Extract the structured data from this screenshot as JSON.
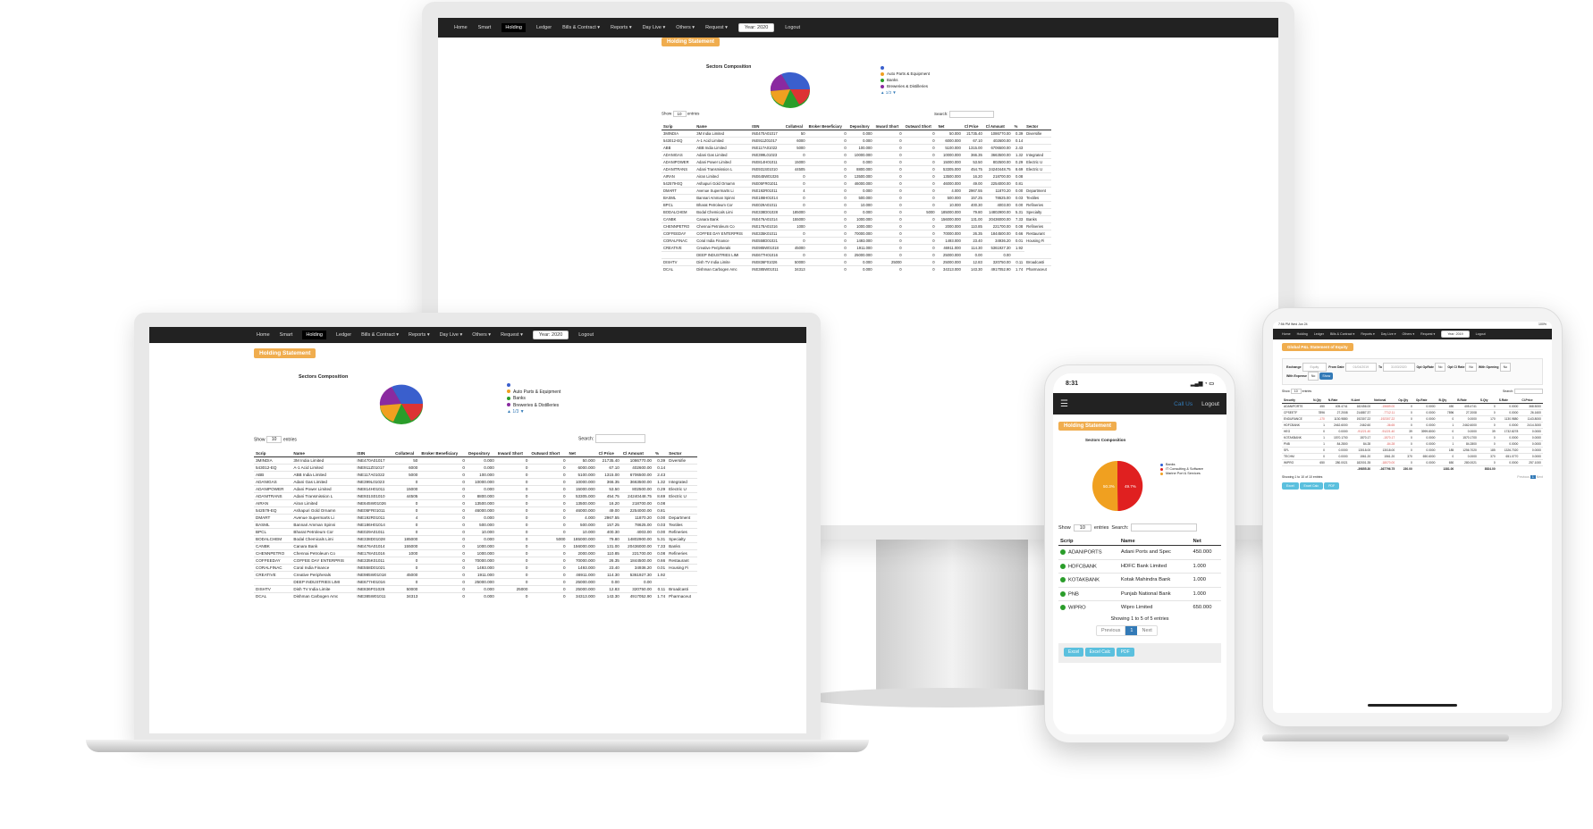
{
  "nav": {
    "items": [
      "Home",
      "Smart",
      "Holding",
      "Ledger",
      "Bills & Contract ▾",
      "Reports ▾",
      "Day Live ▾",
      "Others ▾",
      "Request ▾"
    ],
    "year": "Year: 2020",
    "logout": "Logout"
  },
  "holding": {
    "title": "Holding Statement",
    "chart_title": "Sectors Composition",
    "legend": [
      {
        "label": "",
        "color": "#3a5fcd"
      },
      {
        "label": "Auto Parts & Equipment",
        "color": "#f0a020"
      },
      {
        "label": "Banks",
        "color": "#2a9d2a"
      },
      {
        "label": "Breweries & Distilleries",
        "color": "#8a2aa0"
      }
    ],
    "pager": "1/3",
    "show_prefix": "Show",
    "show_value": "10",
    "show_suffix": "entries",
    "search_label": "Search:",
    "columns": [
      "Scrip",
      "Name",
      "ISIN",
      "Collateral",
      "Broker Beneficiary",
      "Depository",
      "Inward Short",
      "Outward Short",
      "Net",
      "Cl Price",
      "Cl Amount",
      "%",
      "Sector"
    ],
    "rows": [
      [
        "3MINDIA",
        "3M India Limited",
        "INE470A01017",
        "50",
        "0",
        "0.000",
        "0",
        "0",
        "50.000",
        "21735.40",
        "1086770.00",
        "0.39",
        "Diversifie"
      ],
      [
        "543012-EQ",
        "A-1 Acid Limited",
        "INE911Z01017",
        "6000",
        "0",
        "0.000",
        "0",
        "0",
        "6000.000",
        "67.10",
        "402600.00",
        "0.14",
        ""
      ],
      [
        "ABB",
        "ABB India Limited",
        "INE117A01022",
        "5000",
        "0",
        "100.000",
        "0",
        "0",
        "5100.000",
        "1315.00",
        "6706500.00",
        "2.43",
        ""
      ],
      [
        "ADANIGAS",
        "Adani Gas Limited",
        "INE399L01023",
        "0",
        "0",
        "10000.000",
        "0",
        "0",
        "10000.000",
        "366.35",
        "3663500.00",
        "1.32",
        "Integrated"
      ],
      [
        "ADANIPOWER",
        "Adani Power Limited",
        "INE814H01011",
        "15000",
        "0",
        "0.000",
        "0",
        "0",
        "15000.000",
        "53.50",
        "802500.00",
        "0.29",
        "Electric U"
      ],
      [
        "ADANITRANS",
        "Adani Transmission L",
        "INE931S01010",
        "44505",
        "0",
        "8800.000",
        "0",
        "0",
        "53305.000",
        "454.75",
        "24240448.75",
        "8.69",
        "Electric U"
      ],
      [
        "AIRAN",
        "Airan Limited",
        "INE645W01026",
        "0",
        "0",
        "13500.000",
        "0",
        "0",
        "13500.000",
        "16.20",
        "218700.00",
        "0.08",
        ""
      ],
      [
        "542579-EQ",
        "Ashapuri Gold Ornamn",
        "INE05FR01011",
        "0",
        "0",
        "46000.000",
        "0",
        "0",
        "46000.000",
        "49.00",
        "2254000.00",
        "0.81",
        ""
      ],
      [
        "DMART",
        "Avenue Supermarts Li",
        "INE192R01011",
        "4",
        "0",
        "0.000",
        "0",
        "0",
        "4.000",
        "2967.55",
        "11870.20",
        "0.00",
        "Department"
      ],
      [
        "BASML",
        "Bannari Amman Spinni",
        "INE186H01014",
        "0",
        "0",
        "500.000",
        "0",
        "0",
        "500.000",
        "157.25",
        "78625.00",
        "0.03",
        "Textiles"
      ],
      [
        "BPCL",
        "Bharat Petroleum Cor",
        "INE029A01011",
        "0",
        "0",
        "10.000",
        "0",
        "0",
        "10.000",
        "400.30",
        "4003.00",
        "0.00",
        "Refineries"
      ],
      [
        "BODALCHEM",
        "Bodal Chemicals Limi",
        "INE338D01028",
        "185000",
        "0",
        "0.000",
        "0",
        "5000",
        "185000.000",
        "79.80",
        "14802900.00",
        "5.31",
        "Specialty"
      ],
      [
        "CANBK",
        "Canara Bank",
        "INE476A01014",
        "155000",
        "0",
        "1000.000",
        "0",
        "0",
        "156000.000",
        "131.00",
        "20436000.00",
        "7.33",
        "Banks"
      ],
      [
        "CHENNPETRO",
        "Chennai Petroleum Co",
        "INE178A01016",
        "1000",
        "0",
        "1000.000",
        "0",
        "0",
        "2000.000",
        "110.85",
        "221700.00",
        "0.08",
        "Refineries"
      ],
      [
        "COFFEEDAY",
        "COFFEE DAY ENTERPRIS",
        "INE335K01011",
        "0",
        "0",
        "70000.000",
        "0",
        "0",
        "70000.000",
        "26.35",
        "1844500.00",
        "0.66",
        "Restaurant"
      ],
      [
        "CORALFINAC",
        "Coral India Finance",
        "INE558D01021",
        "0",
        "0",
        "1493.000",
        "0",
        "0",
        "1493.000",
        "23.40",
        "34936.20",
        "0.01",
        "Housing Fi"
      ],
      [
        "CREATIVE",
        "Creative Peripherals",
        "INE985W01018",
        "45000",
        "0",
        "1911.000",
        "0",
        "0",
        "46911.000",
        "114.30",
        "5361927.30",
        "1.92",
        ""
      ],
      [
        "",
        "DEEP INDUSTRIES LIMI",
        "INE677H01016",
        "0",
        "0",
        "25000.000",
        "0",
        "0",
        "25000.000",
        "0.00",
        "0.00",
        ""
      ],
      [
        "DISHTV",
        "Dish TV India Limite",
        "INE836F01026",
        "50000",
        "0",
        "0.000",
        "25000",
        "0",
        "25000.000",
        "12.83",
        "320750.00",
        "0.11",
        "Broadcasti"
      ],
      [
        "DCAL",
        "Dishman Carbogen Amc",
        "INE385W01011",
        "34313",
        "0",
        "0.000",
        "0",
        "0",
        "34313.000",
        "143.30",
        "4917052.90",
        "1.74",
        "Pharmaceut"
      ]
    ]
  },
  "phone": {
    "time": "8:31",
    "call_us": "Call Us",
    "logout": "Logout",
    "badge": "Holding Statement",
    "chart_title": "Sectors Composition",
    "legend": [
      {
        "label": "Banks",
        "color": "#2a5dd6"
      },
      {
        "label": "IT Consulting & Software",
        "color": "#e02020"
      },
      {
        "label": "Marine Port & Services",
        "color": "#f0a020"
      }
    ],
    "slices": [
      {
        "label": "Banks",
        "value": 0.001,
        "color": "#2a5dd6"
      },
      {
        "label": "IT Consulting & Software",
        "value": 49.7,
        "color": "#e02020"
      },
      {
        "label": "Marine Port & Services",
        "value": 50.3,
        "color": "#f0a020"
      }
    ],
    "slice_labels": [
      "50.3%",
      "49.7%"
    ],
    "show_prefix": "Show",
    "show_value": "10",
    "show_suffix": "entries",
    "search_label": "Search:",
    "columns": [
      "Scrip",
      "Name",
      "Net"
    ],
    "rows": [
      [
        "ADANIPORTS",
        "Adani Ports and Spec",
        "450.000"
      ],
      [
        "HDFCBANK",
        "HDFC Bank Limited",
        "1.000"
      ],
      [
        "KOTAKBANK",
        "Kotak Mahindra Bank",
        "1.000"
      ],
      [
        "PNB",
        "Punjab National Bank",
        "1.000"
      ],
      [
        "WIPRO",
        "Wipro Limited",
        "650.000"
      ]
    ],
    "info": "Showing 1 to 5 of 5 entries",
    "prev": "Previous",
    "page": "1",
    "next": "Next",
    "buttons": [
      "Excel",
      "Excel Calc",
      "PDF"
    ]
  },
  "tablet": {
    "status_time": "7:56 PM  Wed Jun 24",
    "status_right": "100%",
    "nav_items": [
      "Home",
      "Holding",
      "Ledger",
      "Bills & Contract ▾",
      "Reports ▾",
      "Day Live ▾",
      "Others ▾",
      "Request ▾"
    ],
    "year": "Year: 2019",
    "logout": "Logout",
    "badge": "Global P&L Statement of Equity",
    "filters": {
      "exchange_label": "Exchange",
      "exchange_value": "Equity",
      "from_label": "From Date",
      "from_value": "01/04/2019",
      "to_label": "To",
      "to_value": "31/03/2020",
      "opt_label1": "Opt OpRate",
      "opt_value1": "No",
      "opt_label2": "Opt Cl Rate",
      "opt_value2": "No",
      "with_opening_label": "With Opening",
      "with_opening_value": "No",
      "with_expense_label": "With Expense",
      "with_expense_value": "No",
      "go": "Show"
    },
    "show_prefix": "Show",
    "show_value": "10",
    "show_suffix": "entries",
    "search_label": "Search:",
    "columns": [
      "Security",
      "N.Qty",
      "N.Rate",
      "N.Amt",
      "Notional",
      "Op.Qty",
      "Op.Rate",
      "B.Qty",
      "B.Rate",
      "S.Qty",
      "S.Rate",
      "Cl.Price"
    ],
    "rows": [
      [
        "ADANIPORTS",
        "450",
        "405.4741",
        "182456.00",
        "-15689.00",
        "0",
        "0.0000",
        "450",
        "405.4741",
        "0",
        "0.0000",
        "368.5000"
      ],
      [
        "CPSEETF",
        "7896",
        "27.2008",
        "214887.37",
        "-7712.11",
        "0",
        "0.0000",
        "7896",
        "27.2008",
        "0",
        "0.0000",
        "26.1600"
      ],
      [
        "ENDURANCE",
        "-170",
        "1130.9880",
        "192307.22",
        "-192307.22",
        "0",
        "0.0000",
        "0",
        "0.0000",
        "170",
        "1130.9880",
        "1143.8000"
      ],
      [
        "HDFCBANK",
        "1",
        "2462.6000",
        "2462.60",
        "-36.65",
        "0",
        "0.0000",
        "1",
        "2462.6000",
        "0",
        "0.0000",
        "2414.3000"
      ],
      [
        "HEG",
        "0",
        "0.0000",
        "-91221.40",
        "-91221.40",
        "39",
        "3999.8000",
        "0",
        "0.0000",
        "39",
        "1732.8278",
        "0.0000"
      ],
      [
        "KOTAKBANK",
        "1",
        "1570.1700",
        "1570.17",
        "-1570.17",
        "0",
        "0.0000",
        "1",
        "1570.1700",
        "0",
        "0.0000",
        "0.0000"
      ],
      [
        "PNB",
        "1",
        "84.2800",
        "84.28",
        "-84.28",
        "0",
        "0.0000",
        "1",
        "84.2800",
        "0",
        "0.0000",
        "0.0000"
      ],
      [
        "SFL",
        "0",
        "0.0000",
        "13018.00",
        "13018.00",
        "0",
        "0.0000",
        "185",
        "1256.7020",
        "185",
        "1326.7020",
        "0.0000"
      ],
      [
        "TECHM",
        "0",
        "0.0000",
        "1561.20",
        "1561.20",
        "370",
        "650.6000",
        "0",
        "0.0000",
        "370",
        "651.0770",
        "0.0000"
      ],
      [
        "WIPRO",
        "650",
        "280.0021",
        "182001.35",
        "-18070.00",
        "0",
        "0.0000",
        "650",
        "280.0021",
        "0",
        "0.0000",
        "257.1000"
      ]
    ],
    "totals": [
      "",
      "",
      "",
      "-39855.30",
      "-367796.75",
      "230.00",
      "",
      "1381.00",
      "",
      "8524.00",
      "",
      ""
    ],
    "info": "Showing 1 to 10 of 10 entries",
    "prev": "Previous",
    "page": "1",
    "next": "Next",
    "buttons": [
      "Excel",
      "Excel Calc",
      "PDF"
    ]
  }
}
